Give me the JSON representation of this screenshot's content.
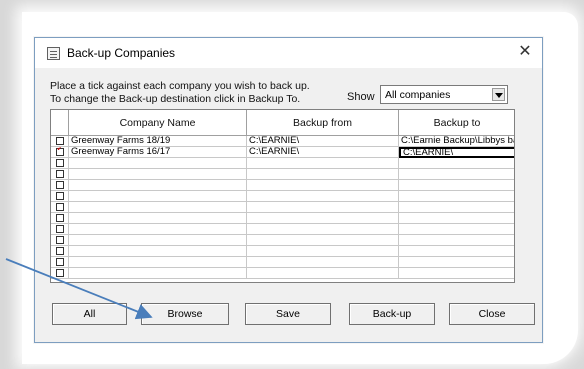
{
  "window": {
    "title": "Back-up Companies",
    "close_glyph": "✕"
  },
  "instructions": {
    "line1": "Place a tick against each company you wish to back up.",
    "line2": "To change the Back-up destination click in Backup To."
  },
  "filter": {
    "label": "Show",
    "selected": "All companies"
  },
  "grid": {
    "columns": [
      "",
      "Company Name",
      "Backup from",
      "Backup to"
    ],
    "rows": [
      {
        "checked": false,
        "company": "Greenway Farms 18/19",
        "from": "C:\\EARNIE\\",
        "to": "C:\\Earnie Backup\\Libbys backup"
      },
      {
        "checked": true,
        "company": "Greenway Farms 16/17",
        "from": "C:\\EARNIE\\",
        "to": "C:\\EARNIE\\"
      },
      {
        "checked": false,
        "company": "",
        "from": "",
        "to": ""
      },
      {
        "checked": false,
        "company": "",
        "from": "",
        "to": ""
      },
      {
        "checked": false,
        "company": "",
        "from": "",
        "to": ""
      },
      {
        "checked": false,
        "company": "",
        "from": "",
        "to": ""
      },
      {
        "checked": false,
        "company": "",
        "from": "",
        "to": ""
      },
      {
        "checked": false,
        "company": "",
        "from": "",
        "to": ""
      },
      {
        "checked": false,
        "company": "",
        "from": "",
        "to": ""
      },
      {
        "checked": false,
        "company": "",
        "from": "",
        "to": ""
      },
      {
        "checked": false,
        "company": "",
        "from": "",
        "to": ""
      },
      {
        "checked": false,
        "company": "",
        "from": "",
        "to": ""
      },
      {
        "checked": false,
        "company": "",
        "from": "",
        "to": ""
      }
    ]
  },
  "buttons": {
    "all": "All",
    "browse": "Browse",
    "save": "Save",
    "backup": "Back-up",
    "close": "Close"
  },
  "annotation": {
    "arrow_color": "#4a7ebb"
  }
}
